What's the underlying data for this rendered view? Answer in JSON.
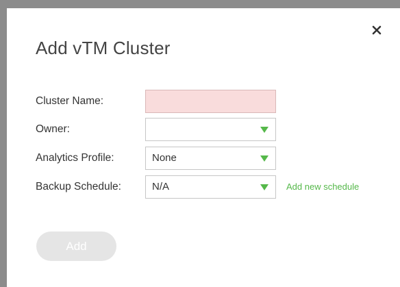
{
  "dialog": {
    "title": "Add vTM Cluster",
    "close_icon": "close-icon"
  },
  "form": {
    "cluster_name": {
      "label": "Cluster Name:",
      "value": ""
    },
    "owner": {
      "label": "Owner:",
      "selected": ""
    },
    "analytics_profile": {
      "label": "Analytics Profile:",
      "selected": "None"
    },
    "backup_schedule": {
      "label": "Backup Schedule:",
      "selected": "N/A",
      "link": "Add new schedule"
    }
  },
  "actions": {
    "add_label": "Add"
  },
  "colors": {
    "accent_green": "#55b84a",
    "invalid_field_bg": "#f9dcdc",
    "disabled_button_bg": "#e5e5e5"
  }
}
